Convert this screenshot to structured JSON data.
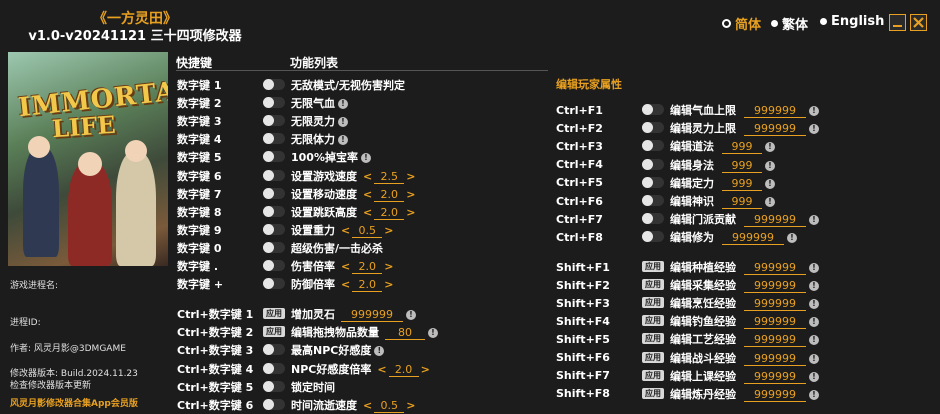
{
  "header": {
    "title": "《一方灵田》",
    "subtitle": "v1.0-v20241121 三十四项修改器"
  },
  "languages": [
    {
      "label": "简体",
      "active": true
    },
    {
      "label": "繁体",
      "active": false
    },
    {
      "label": "English",
      "active": false
    }
  ],
  "cover": {
    "logo_line1": "IMMORTAL",
    "logo_line2": "LIFE"
  },
  "left_info": {
    "process_name_label": "游戏进程名:",
    "process_id_label": "进程ID:",
    "author": "作者: 风灵月影@3DMGAME",
    "version": "修改器版本: Build.2024.11.23",
    "check_update": "检查修改器版本更新",
    "footer": "风灵月影修改器合集App会员版"
  },
  "columns": {
    "hotkey": "快捷键",
    "functions": "功能列表"
  },
  "left_rows": [
    {
      "key": "数字键 1",
      "label": "无敌模式/无视伤害判定"
    },
    {
      "key": "数字键 2",
      "label": "无限气血",
      "info": true
    },
    {
      "key": "数字键 3",
      "label": "无限灵力",
      "info": true
    },
    {
      "key": "数字键 4",
      "label": "无限体力",
      "info": true
    },
    {
      "key": "数字键 5",
      "label": "100%掉宝率",
      "info": true
    },
    {
      "key": "数字键 6",
      "label": "设置游戏速度",
      "value": "2.5"
    },
    {
      "key": "数字键 7",
      "label": "设置移动速度",
      "value": "2.0"
    },
    {
      "key": "数字键 8",
      "label": "设置跳跃高度",
      "value": "2.0"
    },
    {
      "key": "数字键 9",
      "label": "设置重力",
      "value": "0.5"
    },
    {
      "key": "数字键 0",
      "label": "超级伤害/一击必杀"
    },
    {
      "key": "数字键 .",
      "label": "伤害倍率",
      "value": "2.0"
    },
    {
      "key": "数字键 +",
      "label": "防御倍率",
      "value": "2.0"
    }
  ],
  "ctrl_rows": [
    {
      "key": "Ctrl+数字键 1",
      "apply": "应用",
      "label": "增加灵石",
      "input": "999999",
      "info": true
    },
    {
      "key": "Ctrl+数字键 2",
      "apply": "应用",
      "label": "编辑拖拽物品数量",
      "input": "80",
      "info": true
    },
    {
      "key": "Ctrl+数字键 3",
      "label": "最高NPC好感度",
      "info": true
    },
    {
      "key": "Ctrl+数字键 4",
      "label": "NPC好感度倍率",
      "value": "2.0"
    },
    {
      "key": "Ctrl+数字键 5",
      "label": "锁定时间"
    },
    {
      "key": "Ctrl+数字键 6",
      "label": "时间流逝速度",
      "value": "0.5"
    }
  ],
  "player_section": "编辑玩家属性",
  "player_rows": [
    {
      "key": "Ctrl+F1",
      "label": "编辑气血上限",
      "input": "999999"
    },
    {
      "key": "Ctrl+F2",
      "label": "编辑灵力上限",
      "input": "999999"
    },
    {
      "key": "Ctrl+F3",
      "label": "编辑道法",
      "input": "999"
    },
    {
      "key": "Ctrl+F4",
      "label": "编辑身法",
      "input": "999"
    },
    {
      "key": "Ctrl+F5",
      "label": "编辑定力",
      "input": "999"
    },
    {
      "key": "Ctrl+F6",
      "label": "编辑神识",
      "input": "999"
    },
    {
      "key": "Ctrl+F7",
      "label": "编辑门派贡献",
      "input": "999999"
    },
    {
      "key": "Ctrl+F8",
      "label": "编辑修为",
      "input": "999999"
    }
  ],
  "shift_rows": [
    {
      "key": "Shift+F1",
      "apply": "应用",
      "label": "编辑种植经验",
      "input": "999999"
    },
    {
      "key": "Shift+F2",
      "apply": "应用",
      "label": "编辑采集经验",
      "input": "999999"
    },
    {
      "key": "Shift+F3",
      "apply": "应用",
      "label": "编辑烹饪经验",
      "input": "999999"
    },
    {
      "key": "Shift+F4",
      "apply": "应用",
      "label": "编辑钓鱼经验",
      "input": "999999"
    },
    {
      "key": "Shift+F5",
      "apply": "应用",
      "label": "编辑工艺经验",
      "input": "999999"
    },
    {
      "key": "Shift+F6",
      "apply": "应用",
      "label": "编辑战斗经验",
      "input": "999999"
    },
    {
      "key": "Shift+F7",
      "apply": "应用",
      "label": "编辑上课经验",
      "input": "999999"
    },
    {
      "key": "Shift+F8",
      "apply": "应用",
      "label": "编辑炼丹经验",
      "input": "999999"
    }
  ],
  "icons": {
    "info": "info-icon",
    "minimize": "minimize-icon",
    "close": "close-icon"
  },
  "colors": {
    "accent": "#e8a020",
    "background": "#1c1c1c"
  }
}
